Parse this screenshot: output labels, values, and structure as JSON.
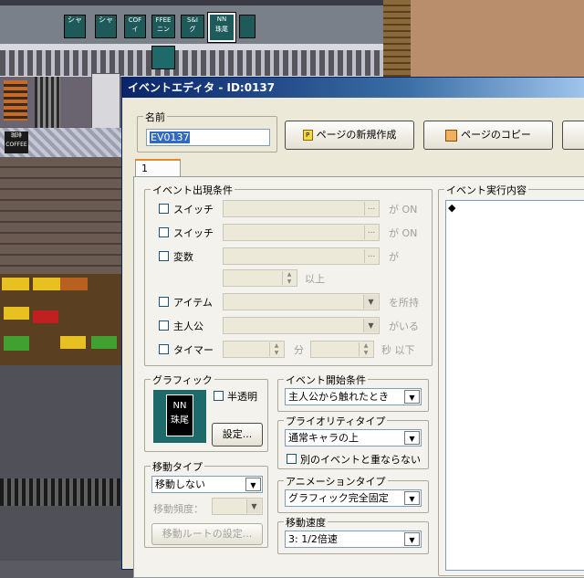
{
  "window": {
    "title": "イベントエディタ - ID:0137"
  },
  "map_tiles": {
    "labels": [
      "シャ",
      "COF\nイ",
      "FFEE\nニン",
      "S&I\nグ",
      "NN\n珠尾"
    ],
    "cafe_sign": "珈琲\nCOFFEE"
  },
  "name_section": {
    "label": "名前",
    "value": "EV0137"
  },
  "toolbar": {
    "new_page": "ページの新規作成",
    "copy_page": "ページのコピー"
  },
  "tabs": [
    {
      "label": "1"
    }
  ],
  "conditions": {
    "title": "イベント出現条件",
    "switch1": "スイッチ",
    "switch1_suffix": "が ON",
    "switch2": "スイッチ",
    "switch2_suffix": "が ON",
    "variable": "変数",
    "variable_suffix": "が",
    "threshold_suffix": "以上",
    "item": "アイテム",
    "item_suffix": "を所持",
    "actor": "主人公",
    "actor_suffix": "がいる",
    "timer": "タイマー",
    "timer_min": "分",
    "timer_sec": "秒 以下"
  },
  "graphic": {
    "title": "グラフィック",
    "semi_transparent": "半透明",
    "set_button": "設定...",
    "preview_text": "NN\n珠尾"
  },
  "move_type": {
    "title": "移動タイプ",
    "value": "移動しない",
    "frequency_label": "移動頻度：",
    "route_button": "移動ルートの設定..."
  },
  "trigger": {
    "title": "イベント開始条件",
    "value": "主人公から触れたとき"
  },
  "priority": {
    "title": "プライオリティタイプ",
    "value": "通常キャラの上",
    "no_overlap": "別のイベントと重ならない"
  },
  "animation": {
    "title": "アニメーションタイプ",
    "value": "グラフィック完全固定"
  },
  "speed": {
    "title": "移動速度",
    "value": "3: 1/2倍速"
  },
  "commands": {
    "title": "イベント実行内容",
    "first_line": "◆"
  }
}
